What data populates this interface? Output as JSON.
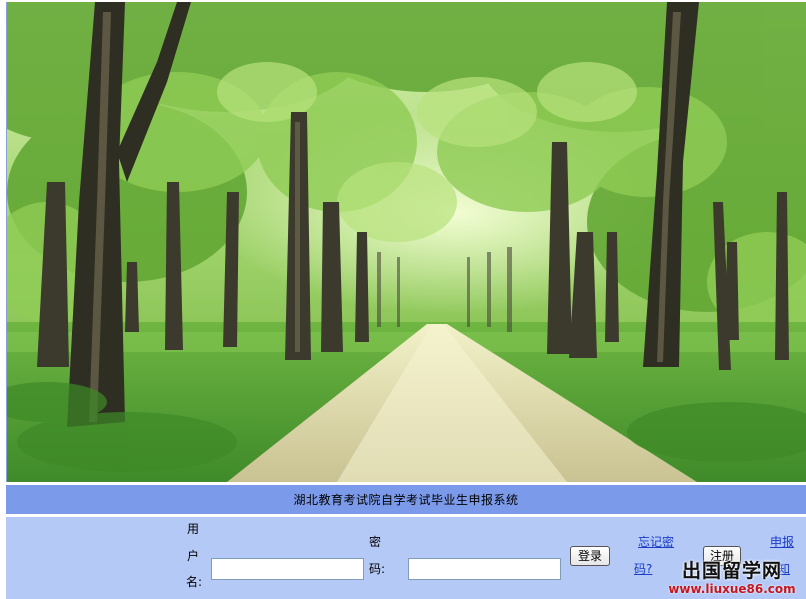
{
  "hero": {
    "image": "forest-path-photo"
  },
  "title_bar": {
    "title": "湖北教育考试院自学考试毕业生申报系统"
  },
  "login": {
    "username_label_chars": [
      "用",
      "户",
      "名:"
    ],
    "username_value": "",
    "password_label_chars": [
      "密",
      "码:"
    ],
    "password_value": "",
    "login_button": "登录",
    "forgot_password_line1": "忘记密",
    "forgot_password_line2": "码?",
    "register_button": "注册",
    "notice_line1": "申报",
    "notice_line2": "知"
  },
  "watermark": {
    "main": "出国留学网",
    "sub": "www.liuxue86.com"
  },
  "colors": {
    "title_bar": "#7b9aea",
    "login_bar": "#b5c9f7",
    "link": "#1a3cc8",
    "watermark_red": "#c4161c"
  }
}
